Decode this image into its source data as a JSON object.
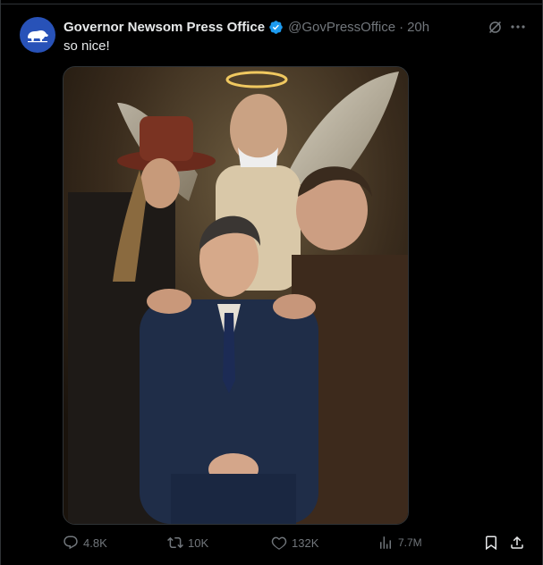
{
  "tweet": {
    "author_name": "Governor Newsom Press Office",
    "handle": "@GovPressOffice",
    "separator": "·",
    "time": "20h",
    "text": "so nice!",
    "avatar_icon": "california-bear-icon",
    "image_description_icon": "painting-image"
  },
  "actions": {
    "replies": "4.8K",
    "reposts": "10K",
    "likes": "132K",
    "views": "7.7M"
  },
  "colors": {
    "background": "#000000",
    "text": "#e7e9ea",
    "muted": "#71767b",
    "verified": "#1d9bf0",
    "avatar_bg": "#2852b8"
  }
}
